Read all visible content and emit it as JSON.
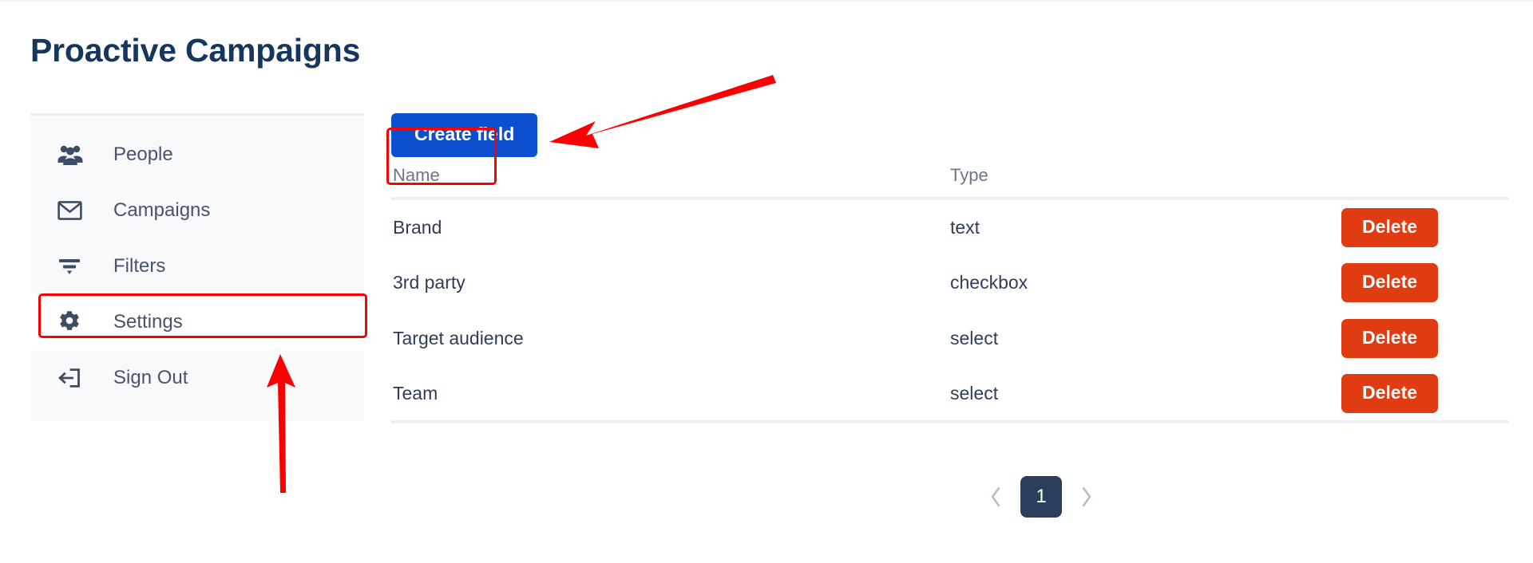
{
  "page": {
    "title": "Proactive Campaigns"
  },
  "sidebar": {
    "items": [
      {
        "label": "People",
        "icon": "people-icon",
        "active": false
      },
      {
        "label": "Campaigns",
        "icon": "envelope-icon",
        "active": false
      },
      {
        "label": "Filters",
        "icon": "filter-icon",
        "active": false
      },
      {
        "label": "Settings",
        "icon": "gear-icon",
        "active": true
      },
      {
        "label": "Sign Out",
        "icon": "sign-out-icon",
        "active": false
      }
    ]
  },
  "main": {
    "create_button_label": "Create field",
    "table": {
      "columns": [
        "Name",
        "Type",
        ""
      ],
      "rows": [
        {
          "name": "Brand",
          "type": "text",
          "action": "Delete"
        },
        {
          "name": "3rd party",
          "type": "checkbox",
          "action": "Delete"
        },
        {
          "name": "Target audience",
          "type": "select",
          "action": "Delete"
        },
        {
          "name": "Team",
          "type": "select",
          "action": "Delete"
        }
      ]
    },
    "pagination": {
      "prev_label": "‹",
      "current_page": "1",
      "next_label": "›"
    }
  },
  "annotations": {
    "color": "#fb0000",
    "create_field_highlight": "Create field",
    "settings_highlight": "Settings"
  },
  "colors": {
    "title": "#17365d",
    "primary_button": "#0d50cf",
    "danger_button": "#e03c12",
    "sidebar_bg": "#f7f9fb",
    "pagination_active": "#2b3e5c"
  }
}
